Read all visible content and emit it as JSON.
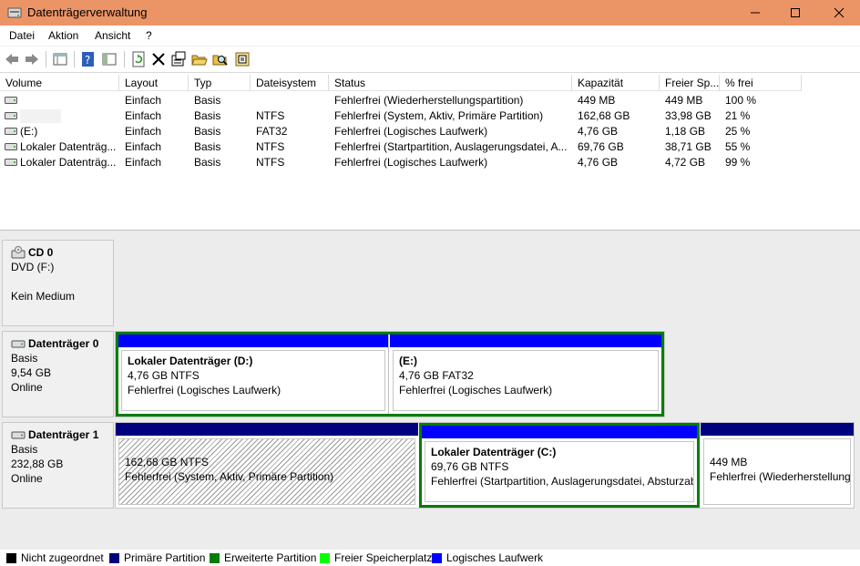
{
  "window": {
    "title": "Datenträgerverwaltung"
  },
  "menu": {
    "items": [
      "Datei",
      "Aktion",
      "Ansicht",
      "?"
    ]
  },
  "table": {
    "columns": [
      "Volume",
      "Layout",
      "Typ",
      "Dateisystem",
      "Status",
      "Kapazität",
      "Freier Sp...",
      "% frei"
    ],
    "rows": [
      {
        "volume": "",
        "layout": "Einfach",
        "typ": "Basis",
        "fs": "",
        "status": "Fehlerfrei (Wiederherstellungspartition)",
        "kap": "449 MB",
        "frei": "449 MB",
        "pct": "100 %"
      },
      {
        "volume": "",
        "layout": "Einfach",
        "typ": "Basis",
        "fs": "NTFS",
        "status": "Fehlerfrei (System, Aktiv, Primäre Partition)",
        "kap": "162,68 GB",
        "frei": "33,98 GB",
        "pct": "21 %"
      },
      {
        "volume": "(E:)",
        "layout": "Einfach",
        "typ": "Basis",
        "fs": "FAT32",
        "status": "Fehlerfrei (Logisches Laufwerk)",
        "kap": "4,76 GB",
        "frei": "1,18 GB",
        "pct": "25 %"
      },
      {
        "volume": "Lokaler Datenträg...",
        "layout": "Einfach",
        "typ": "Basis",
        "fs": "NTFS",
        "status": "Fehlerfrei (Startpartition, Auslagerungsdatei, A...",
        "kap": "69,76 GB",
        "frei": "38,71 GB",
        "pct": "55 %"
      },
      {
        "volume": "Lokaler Datenträg...",
        "layout": "Einfach",
        "typ": "Basis",
        "fs": "NTFS",
        "status": "Fehlerfrei (Logisches Laufwerk)",
        "kap": "4,76 GB",
        "frei": "4,72 GB",
        "pct": "99 %"
      }
    ]
  },
  "disks": {
    "cd0": {
      "name": "CD 0",
      "lines": [
        "DVD (F:)",
        "",
        "Kein Medium"
      ]
    },
    "d0": {
      "name": "Datenträger 0",
      "lines": [
        "Basis",
        "9,54 GB",
        "Online"
      ],
      "p1": {
        "name": "Lokaler Datenträger  (D:)",
        "size": "4,76 GB NTFS",
        "status": "Fehlerfrei (Logisches Laufwerk)"
      },
      "p2": {
        "name": "(E:)",
        "size": "4,76 GB FAT32",
        "status": "Fehlerfrei (Logisches Laufwerk)"
      }
    },
    "d1": {
      "name": "Datenträger 1",
      "lines": [
        "Basis",
        "232,88 GB",
        "Online"
      ],
      "p1": {
        "name": "",
        "size": "162,68 GB NTFS",
        "status": "Fehlerfrei (System, Aktiv, Primäre Partition)"
      },
      "p2": {
        "name": "Lokaler Datenträger  (C:)",
        "size": "69,76 GB NTFS",
        "status": "Fehlerfrei (Startpartition, Auslagerungsdatei, Absturzab"
      },
      "p3": {
        "name": "",
        "size": "449 MB",
        "status": "Fehlerfrei (Wiederherstellungs"
      }
    }
  },
  "legend": [
    {
      "label": "Nicht zugeordnet",
      "color": "#000000"
    },
    {
      "label": "Primäre Partition",
      "color": "#00007e"
    },
    {
      "label": "Erweiterte Partition",
      "color": "#007e00"
    },
    {
      "label": "Freier Speicherplatz",
      "color": "#00ff00"
    },
    {
      "label": "Logisches Laufwerk",
      "color": "#0000ff"
    }
  ],
  "colors": {
    "primary": "#00007e",
    "logical": "#0000ff",
    "extended": "#007e00",
    "titlebar": "#eb9466"
  }
}
